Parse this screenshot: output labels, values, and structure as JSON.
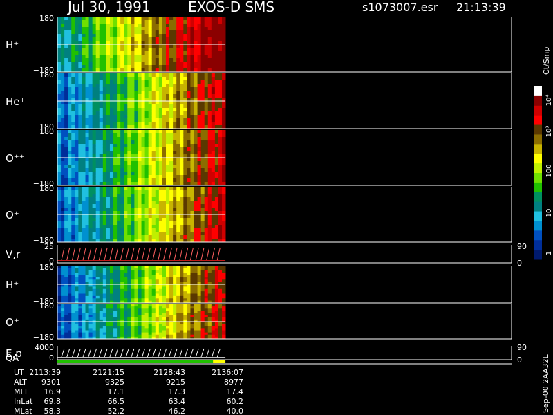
{
  "header": {
    "date": "Jul 30, 1991",
    "instrument": "EXOS-D SMS",
    "file": "s1073007.esr",
    "time": "21:13:39"
  },
  "colorbar": {
    "unit": "Ct/Smp",
    "labels": [
      "10⁴",
      "10³",
      "100",
      "10",
      "1"
    ],
    "colors": [
      "#ffffff",
      "#8b0000",
      "#d00000",
      "#ff0000",
      "#5a3800",
      "#8b6d00",
      "#c8b400",
      "#ffff00",
      "#c0f000",
      "#70e000",
      "#20c000",
      "#009060",
      "#008080",
      "#20c0e0",
      "#0090d0",
      "#0050c0",
      "#002e9a",
      "#001a6e"
    ]
  },
  "chart_data": {
    "type": "heatmap",
    "description_unit_y_colorbar": "Ct/Smp",
    "panels": [
      {
        "label": "H⁺",
        "ymax": "180",
        "ymin": "−180"
      },
      {
        "label": "He⁺",
        "ymax": "180",
        "ymin": "−180"
      },
      {
        "label": "O⁺⁺",
        "ymax": "180",
        "ymin": "−180"
      },
      {
        "label": "O⁺",
        "ymax": "180",
        "ymin": "−180"
      },
      {
        "label": "V,r",
        "ymax": "25",
        "ymin": "0",
        "right_top": "90",
        "right_bottom": "0"
      },
      {
        "label": "H⁺",
        "ymax": "180",
        "ymin": "−180"
      },
      {
        "label": "O⁺",
        "ymax": "180",
        "ymin": "−180"
      },
      {
        "label": "E,p",
        "ymax": "4000",
        "ymin": "0",
        "right_top": "90",
        "right_bottom": "0"
      }
    ],
    "qa_label": "QA",
    "data_fraction_of_time_axis": 0.37,
    "ephemeris": {
      "rows": [
        {
          "name": "UT",
          "values": [
            "2113:39",
            "2121:15",
            "2128:43",
            "2136:07"
          ]
        },
        {
          "name": "ALT",
          "values": [
            "9301",
            "9325",
            "9215",
            "8977"
          ]
        },
        {
          "name": "MLT",
          "values": [
            "16.9",
            "17.1",
            "17.3",
            "17.4"
          ]
        },
        {
          "name": "InLat",
          "values": [
            "69.8",
            "66.5",
            "63.4",
            "60.2"
          ]
        },
        {
          "name": "MLat",
          "values": [
            "58.3",
            "52.2",
            "46.2",
            "40.0"
          ]
        }
      ]
    },
    "side_note": "Sep-00 2AA32L"
  }
}
